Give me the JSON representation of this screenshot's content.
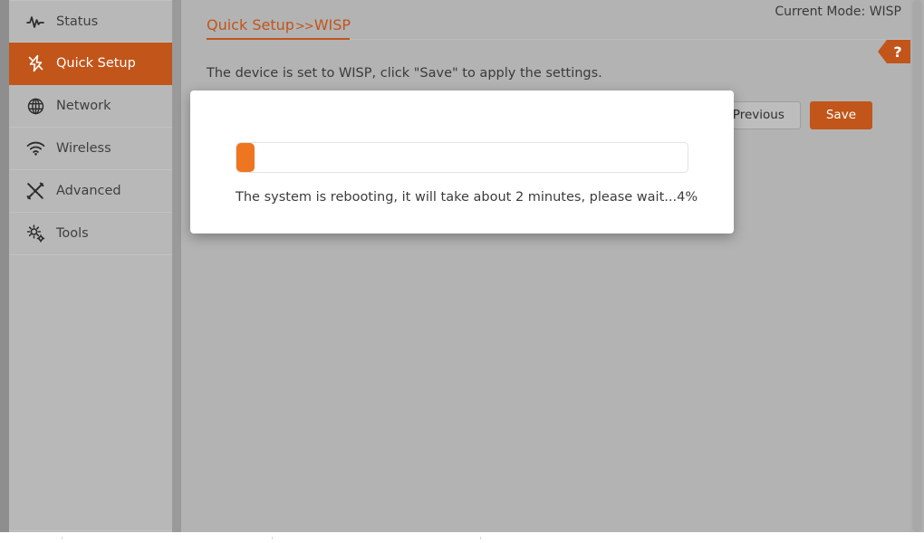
{
  "header": {
    "current_mode_label": "Current Mode: WISP",
    "help_label": "?",
    "help_icon": "question-mark-icon"
  },
  "breadcrumb": {
    "items": [
      "Quick Setup",
      "WISP"
    ],
    "separator": ">>"
  },
  "sidebar": {
    "items": [
      {
        "label": "Status",
        "icon": "pulse-icon",
        "active": false
      },
      {
        "label": "Quick Setup",
        "icon": "bolt-icon",
        "active": true
      },
      {
        "label": "Network",
        "icon": "globe-icon",
        "active": false
      },
      {
        "label": "Wireless",
        "icon": "wifi-icon",
        "active": false
      },
      {
        "label": "Advanced",
        "icon": "tools-icon",
        "active": false
      },
      {
        "label": "Tools",
        "icon": "gears-icon",
        "active": false
      }
    ]
  },
  "main": {
    "info_text": "The device is set to WISP, click \"Save\" to apply the settings.",
    "buttons": {
      "previous_label": "Previous",
      "save_label": "Save"
    }
  },
  "modal": {
    "message": "The system is rebooting, it will take about 2 minutes, please wait...4%",
    "progress_percent": 4
  },
  "colors": {
    "accent": "#c1551a",
    "progress_fill": "#ee7620",
    "page_background": "#b3b3b3",
    "sidebar_background": "#b8b8b8",
    "text": "#3a3a3a"
  }
}
